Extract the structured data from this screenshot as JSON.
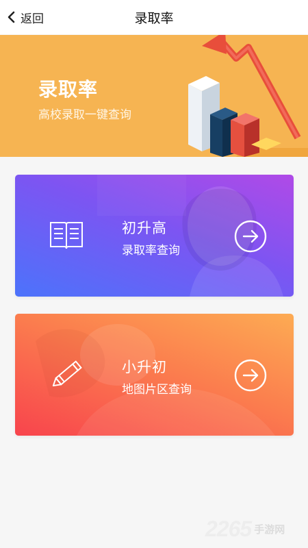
{
  "navbar": {
    "back_label": "返回",
    "title": "录取率"
  },
  "banner": {
    "title": "录取率",
    "subtitle": "高校录取一键查询"
  },
  "cards": [
    {
      "title": "初升高",
      "subtitle": "录取率查询",
      "icon": "book-icon"
    },
    {
      "title": "小升初",
      "subtitle": "地图片区查询",
      "icon": "pencil-icon"
    }
  ],
  "watermark": {
    "number": "2265",
    "site": "手游网"
  },
  "colors": {
    "banner_bg": "#f6b452",
    "card1_gradient": [
      "#b04ae7",
      "#4c73fb"
    ],
    "card2_gradient": [
      "#fdab53",
      "#f8444d"
    ]
  }
}
